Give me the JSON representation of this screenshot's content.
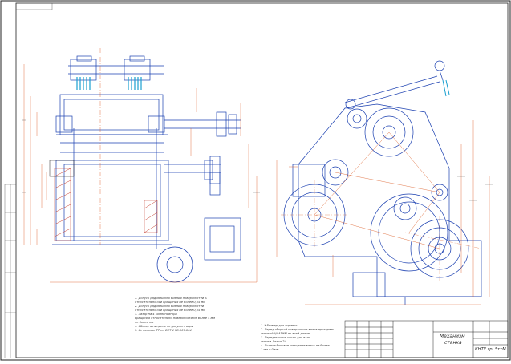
{
  "notes_left": [
    "1. Допуск радиального биения поверхностей Б",
    "   относительно оси вращения не более 0,05 мм",
    "2. Допуск радиального биения поверхностей",
    "   относительно оси вращения не более 0,05 мм",
    "3. Зазор на 4 компенсатора",
    "   вращения относительно поверхности не более 4 мм",
    "   не более мм",
    "4. Сборку шпинделя по документации",
    "5. Остальные ТТ по ОСТ 4 ГО.007.004"
  ],
  "notes_right": [
    "1. * Размер для справок",
    "2. Перед сборкой поверхности валов протереть",
    "   смазкой ЦИАТИМ по всей длине",
    "3. Передаточное число для вала",
    "   смазка  Литол-24",
    "4. Полное боковое смещение валов не более",
    "   1 мм и 0 мм"
  ],
  "title_block": {
    "name_line1": "Механизм",
    "name_line2": "станка",
    "code": "КНТУ гр. 5ттМ"
  },
  "colors": {
    "line": "#1a3fb0",
    "dim": "#d9541a",
    "hatch": "#c43a2a",
    "ink": "#222222"
  }
}
